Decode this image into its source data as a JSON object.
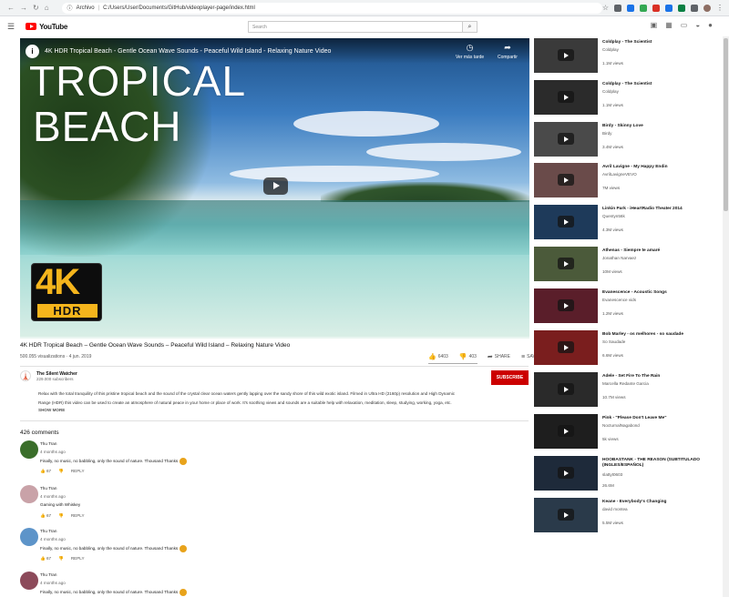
{
  "browser": {
    "secure_label": "Archivo",
    "url": "C:/Users/User/Documents/GitHub/videoplayer-page/index.html"
  },
  "header": {
    "logo_text": "YouTube",
    "search_placeholder": "Search"
  },
  "player": {
    "overlay_title": "4K HDR Tropical Beach - Gentle Ocean Wave Sounds - Peaceful Wild Island - Relaxing Nature Video",
    "watch_later": "Ver más tarde",
    "share": "Compartir",
    "big_title_line1": "TROPICAL",
    "big_title_line2": "BEACH",
    "badge_4k": "4K",
    "badge_hdr": "HDR"
  },
  "video": {
    "title": "4K HDR Tropical Beach – Gentle Ocean Wave Sounds – Peaceful Wild Island – Relaxing Nature Video",
    "views_date": "500.055 visualizations · 4 jun. 2019",
    "likes": "6403",
    "dislikes": "403",
    "share_label": "SHARE",
    "save_label": "SAVE"
  },
  "channel": {
    "name": "The Silent Watcher",
    "subscribers": "229.000 subscribers",
    "subscribe_label": "SUBSCRIBE"
  },
  "description": {
    "line1": "Relax with the total tranquility of this pristine tropical beach and the sound of the crystal clear ocean waters gently lapping over the sandy shore of this wild exotic island. Filmed in Ultra HD (2160p) resolution and High Dynamic",
    "line2": "Range (HDR) this video can be used to create an atmosphere of natural peace in your home or place of work. It's soothing views and sounds are a suitable help with relaxation, meditation, sleep, studying, working, yoga, etc.",
    "show_more": "SHOW MORE"
  },
  "comments": {
    "count_label": "426 comments",
    "items": [
      {
        "name": "Thu Tran",
        "time": "4 months ago",
        "text": "Finally, no music, no babbling, only the sound of nature. Thousand Thanks",
        "likes": "67",
        "reply": "REPLY",
        "avatar_color": "#3a6e2a"
      },
      {
        "name": "Thu Tran",
        "time": "4 months ago",
        "text": "Gaming with Whiskey",
        "likes": "67",
        "reply": "REPLY",
        "avatar_color": "#c9a2a8"
      },
      {
        "name": "Thu Tran",
        "time": "4 months ago",
        "text": "Finally, no music, no babbling, only the sound of nature. Thousand Thanks",
        "likes": "67",
        "reply": "REPLY",
        "avatar_color": "#5d94c9"
      },
      {
        "name": "Thu Tran",
        "time": "4 months ago",
        "text": "Finally, no music, no babbling, only the sound of nature. Thousand Thanks",
        "likes": "",
        "reply": "",
        "avatar_color": "#8c4a5a"
      }
    ]
  },
  "sidebar": {
    "items": [
      {
        "title": "Coldplay - The Scientist",
        "channel": "Coldplay",
        "views": "1.1M views",
        "thumb": "#3a3a3a"
      },
      {
        "title": "Coldplay - The Scientist",
        "channel": "Coldplay",
        "views": "1.1M views",
        "thumb": "#2b2b2b"
      },
      {
        "title": "Birdy - Skinny Love",
        "channel": "Birdy",
        "views": "3.4M views",
        "thumb": "#4a4a4a"
      },
      {
        "title": "Avril Lavigne - My Happy Endin",
        "channel": "AvrilLavigneVEVO",
        "views": "7M views",
        "thumb": "#6a4b4a"
      },
      {
        "title": "Linkin Park - iHeartRadio Theater 2014",
        "channel": "Quentyn56k",
        "views": "4.3M views",
        "thumb": "#1e3a5a"
      },
      {
        "title": "Athenas - Siempre te amaré",
        "channel": "Jonathan Narvaez",
        "views": "10M views",
        "thumb": "#4b5a3a"
      },
      {
        "title": "Evanescence - Acoustic Songs",
        "channel": "Evanescence vids",
        "views": "1.2M views",
        "thumb": "#5a1e2a"
      },
      {
        "title": "Bob Marley - os melhores - so saudade",
        "channel": "So Saudade",
        "views": "6.6M views",
        "thumb": "#7a1e1e"
      },
      {
        "title": "Adele - Set Fire To The Rain",
        "channel": "Marcella Redante Garcia",
        "views": "10.7M views",
        "thumb": "#2a2a2a"
      },
      {
        "title": "Pink - \"Please Don't Leave Me\"",
        "channel": "NocturnalNagabond",
        "views": "5k views",
        "thumb": "#1e1e1e"
      },
      {
        "title": "HOOBASTANK - THE REASON (SUBTITULADO (INGLES/ESPAÑOL)",
        "channel": "slattyt0603",
        "views": "26.6M",
        "thumb": "#1e2a3a"
      },
      {
        "title": "Keane - Everybody's Changing",
        "channel": "david montea",
        "views": "5.5M views",
        "thumb": "#2a3a4a"
      }
    ]
  }
}
